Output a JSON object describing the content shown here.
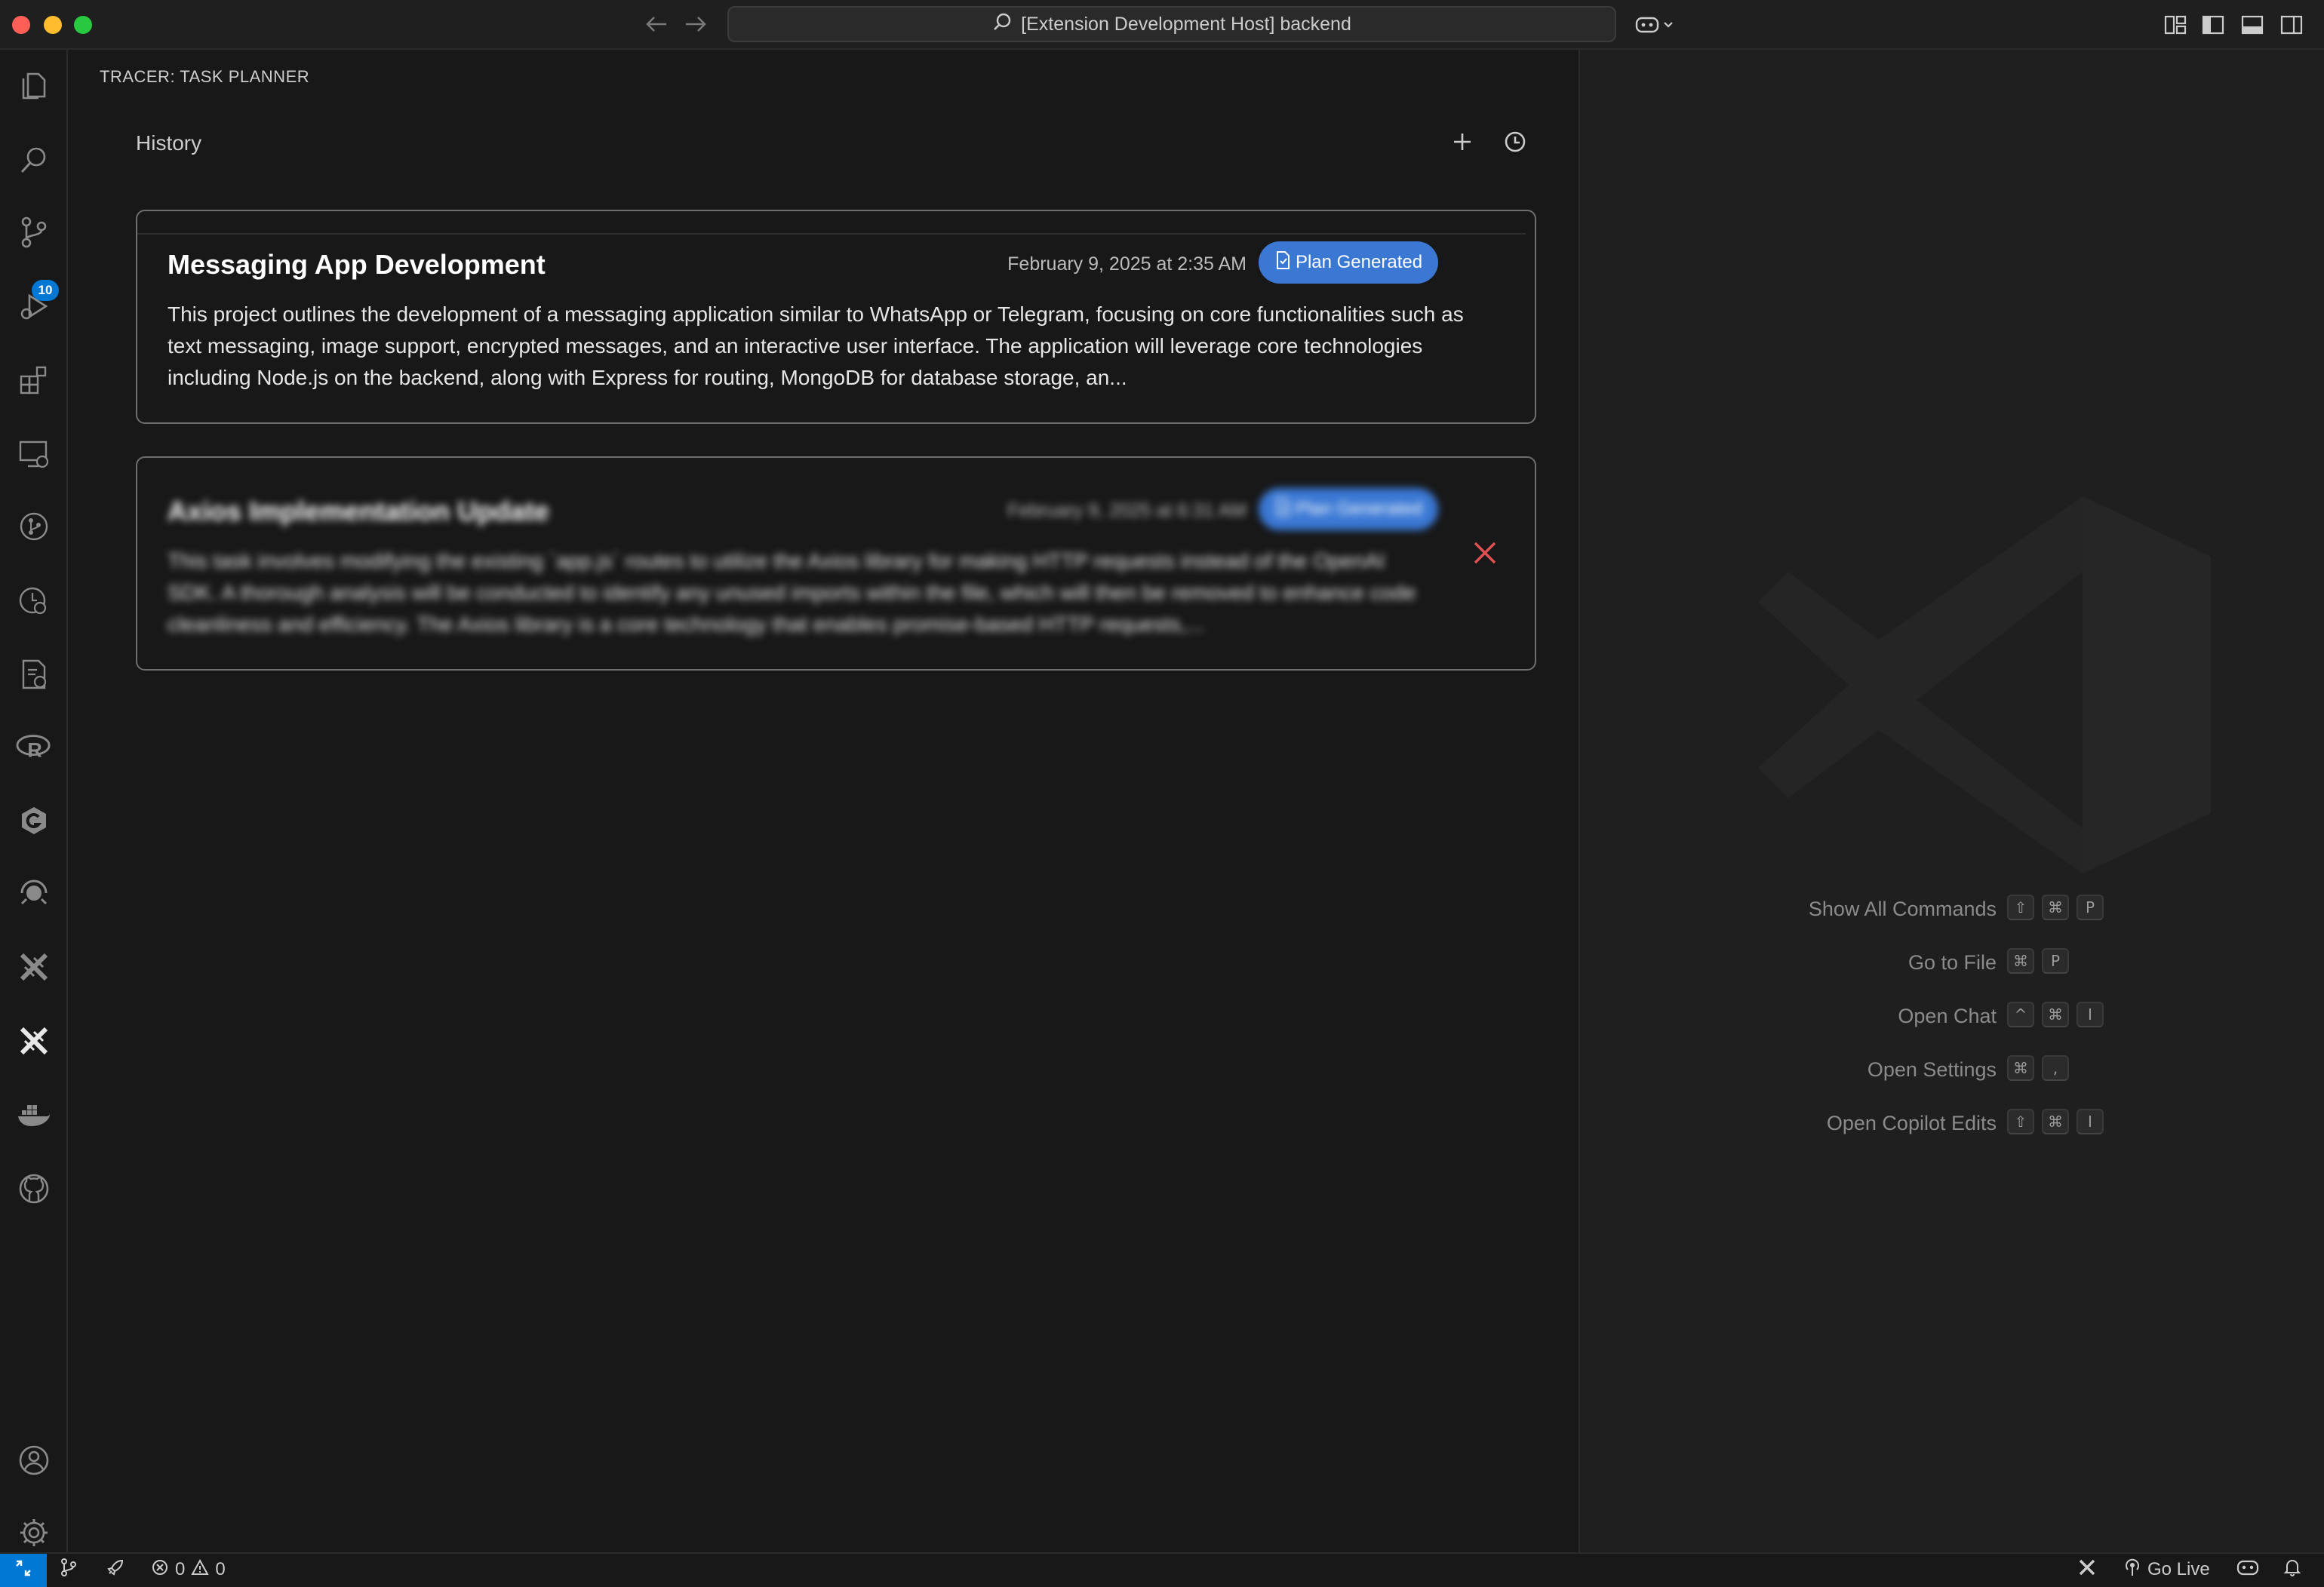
{
  "window": {
    "search_text": "[Extension Development Host] backend"
  },
  "activity_bar": {
    "source_control_badge": "10"
  },
  "panel": {
    "title": "TRACER: TASK PLANNER",
    "history_label": "History",
    "tasks": [
      {
        "title": "Messaging App Development",
        "date": "February 9, 2025 at 2:35 AM",
        "status": "Plan Generated",
        "description": "This project outlines the development of a messaging application similar to WhatsApp or Telegram, focusing on core functionalities such as text messaging, image support, encrypted messages, and an interactive user interface. The application will leverage core technologies including Node.js on the backend, along with Express for routing, MongoDB for database storage, an..."
      },
      {
        "title": "Axios Implementation Update",
        "date": "February 9, 2025 at 6:31 AM",
        "status": "Plan Generated",
        "description": "This task involves modifying the existing `app.js` routes to utilize the Axios library for making HTTP requests instead of the OpenAI SDK. A thorough analysis will be conducted to identify any unused imports within the file, which will then be removed to enhance code cleanliness and efficiency. The Axios library is a core technology that enables promise-based HTTP requests,..."
      }
    ]
  },
  "editor": {
    "shortcuts": [
      {
        "label": "Show All Commands",
        "keys": [
          "⇧",
          "⌘",
          "P"
        ]
      },
      {
        "label": "Go to File",
        "keys": [
          "⌘",
          "P"
        ]
      },
      {
        "label": "Open Chat",
        "keys": [
          "^",
          "⌘",
          "I"
        ]
      },
      {
        "label": "Open Settings",
        "keys": [
          "⌘",
          ","
        ]
      },
      {
        "label": "Open Copilot Edits",
        "keys": [
          "⇧",
          "⌘",
          "I"
        ]
      }
    ]
  },
  "status_bar": {
    "errors": "0",
    "warnings": "0",
    "go_live": "Go Live"
  },
  "colors": {
    "accent": "#0078d4",
    "badge_blue": "#3a78d4",
    "delete_red": "#e05252"
  }
}
